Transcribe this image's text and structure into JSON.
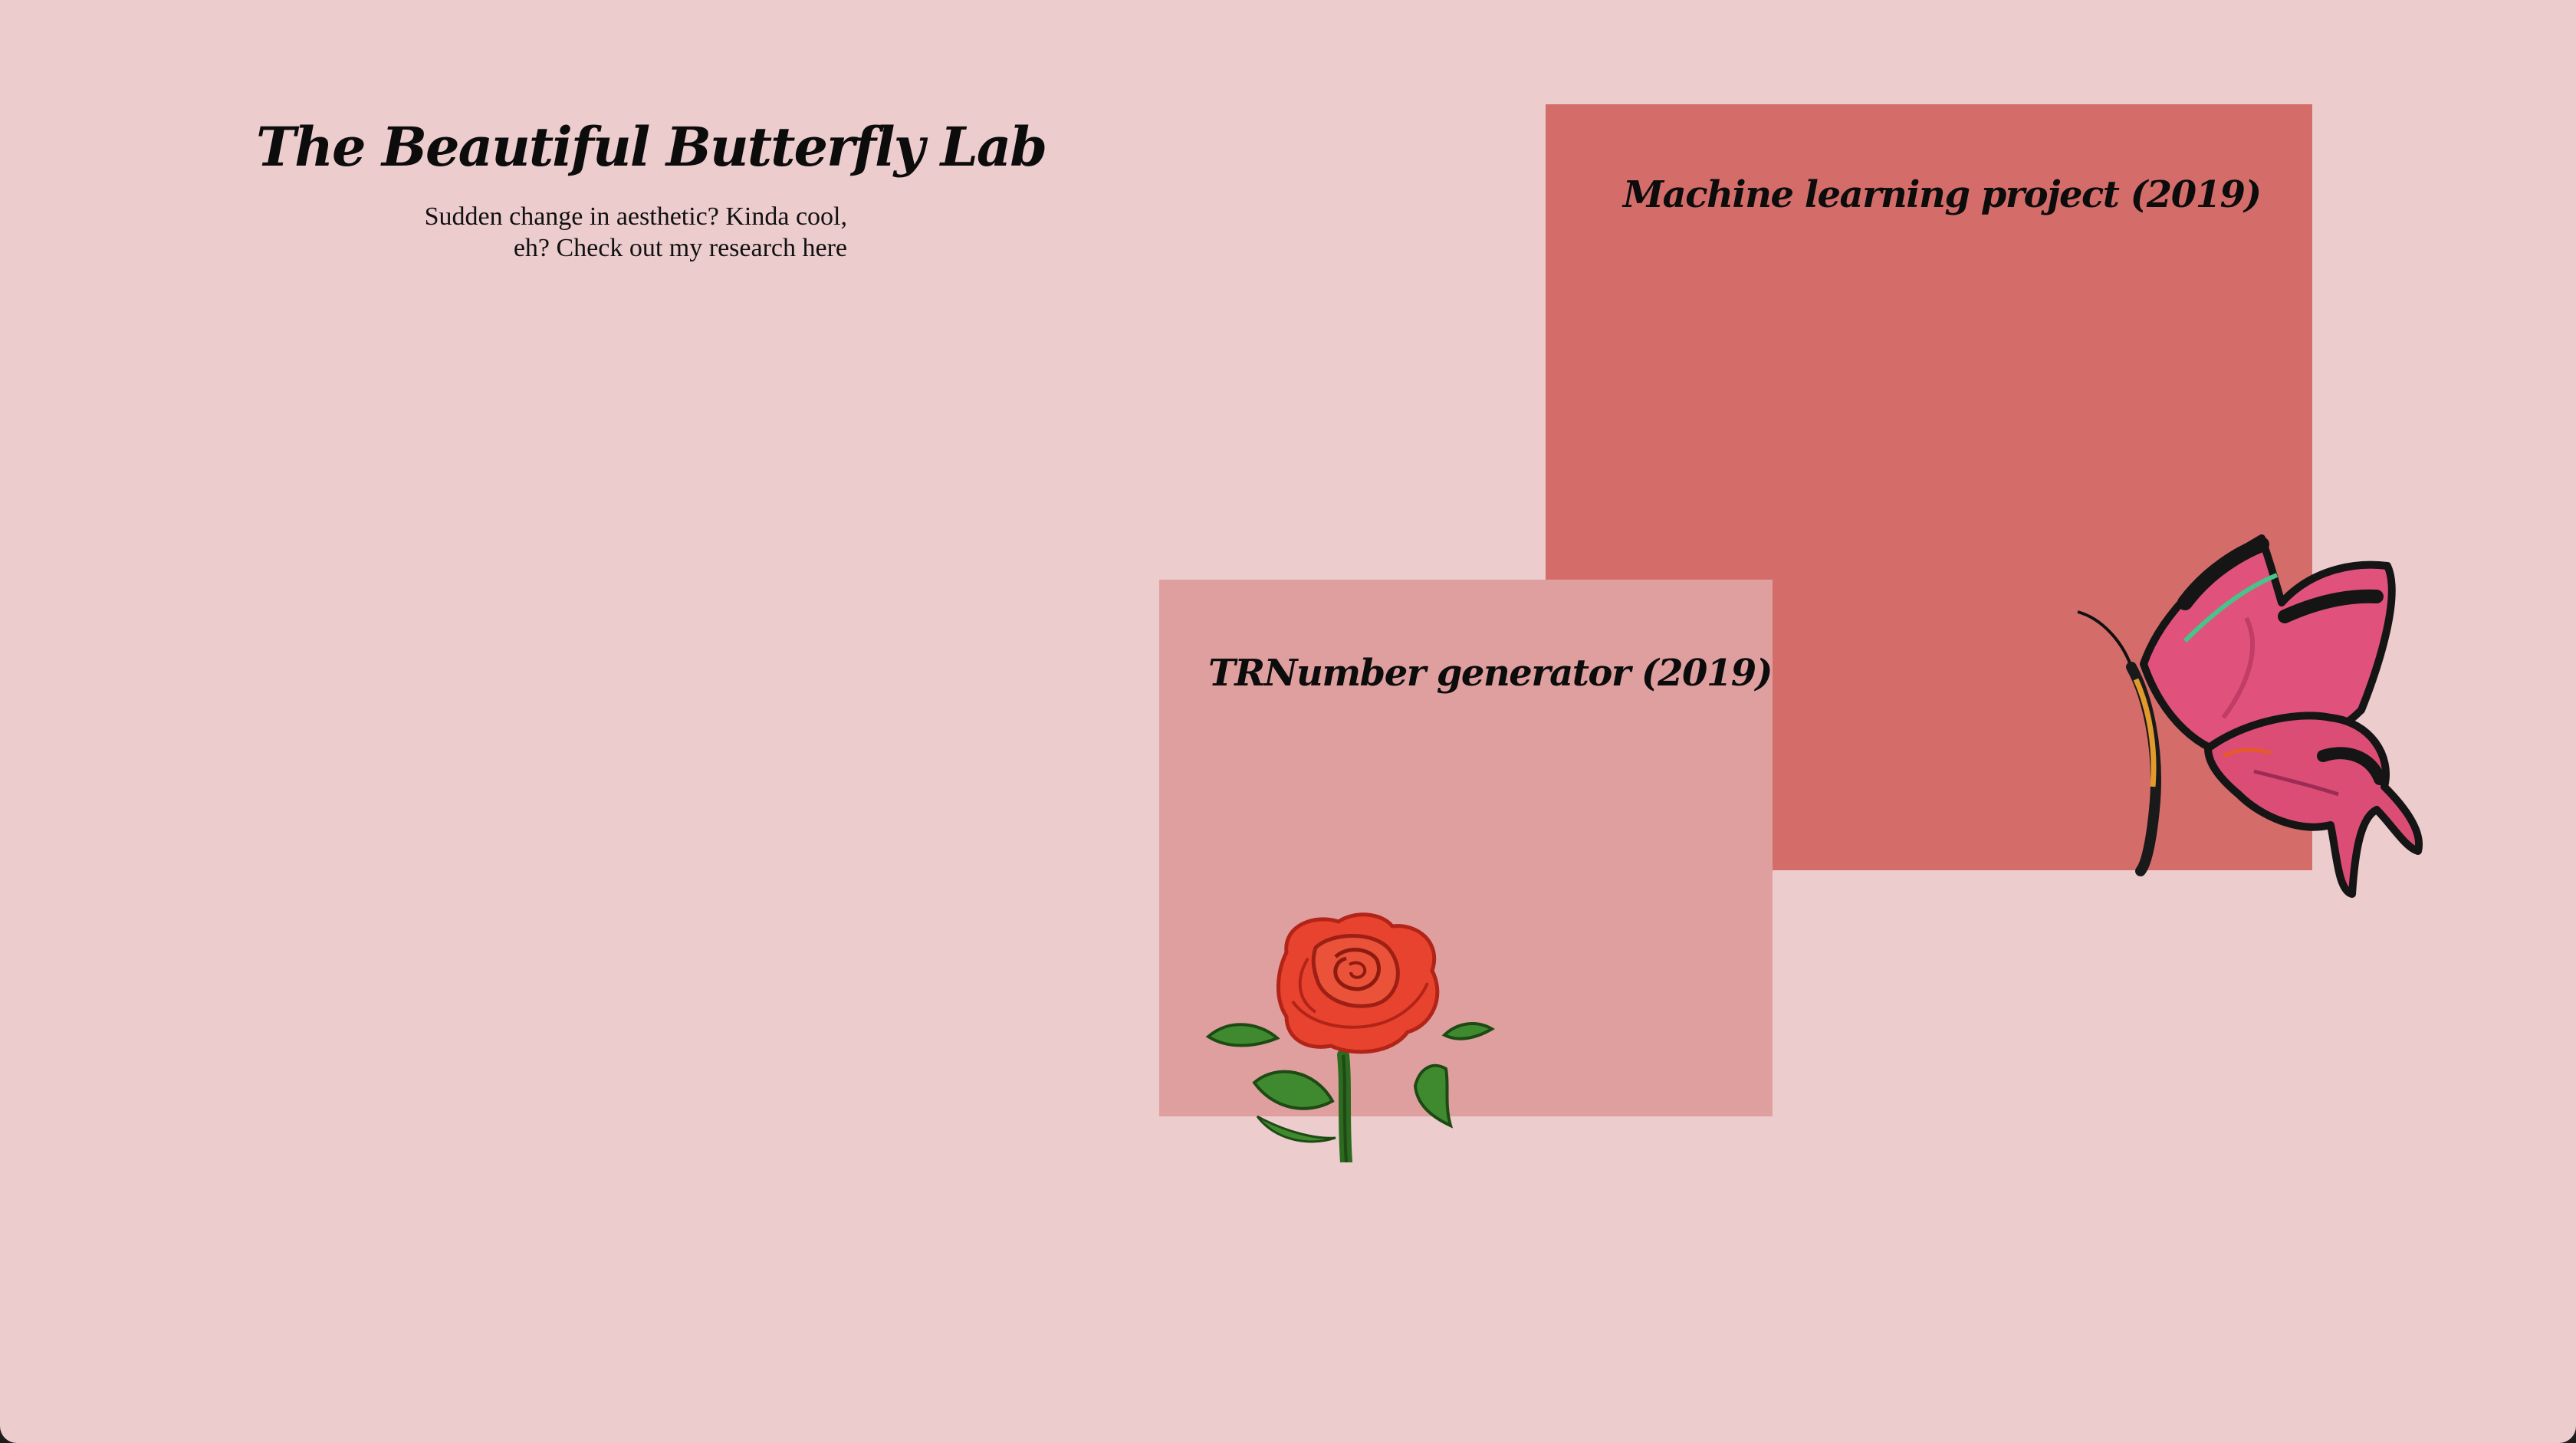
{
  "header": {
    "title": "The Beautiful Butterfly Lab",
    "tagline": "Sudden change in aesthetic? Kinda cool, eh? Check out my research here"
  },
  "projects": [
    {
      "title": "Machine learning project  (2019)",
      "color": "#d46d6a"
    },
    {
      "title": "TRNumber generator  (2019)",
      "color": "#df9f9f"
    }
  ],
  "colors": {
    "background": "#eccccc",
    "text": "#0c0c0c"
  },
  "decorations": {
    "rose": "rose-icon",
    "butterfly": "butterfly-icon"
  }
}
